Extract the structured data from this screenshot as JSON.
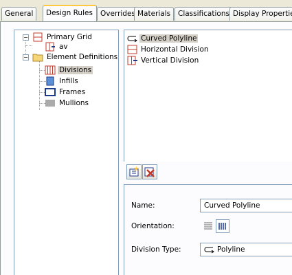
{
  "tabs": [
    {
      "label": "General"
    },
    {
      "label": "Design Rules"
    },
    {
      "label": "Overrides"
    },
    {
      "label": "Materials"
    },
    {
      "label": "Classifications"
    },
    {
      "label": "Display Properties"
    }
  ],
  "tree": {
    "primary_grid": "Primary Grid",
    "av": "av",
    "element_definitions": "Element Definitions",
    "divisions": "Divisions",
    "infills": "Infills",
    "frames": "Frames",
    "mullions": "Mullions"
  },
  "list": {
    "items": [
      {
        "label": "Curved Polyline"
      },
      {
        "label": "Horizontal Division"
      },
      {
        "label": "Vertical Division"
      }
    ]
  },
  "properties": {
    "name_label": "Name:",
    "name_value": "Curved Polyline",
    "orientation_label": "Orientation:",
    "division_type_label": "Division Type:",
    "division_type_value": "Polyline"
  },
  "colors": {
    "tab_active_accent": "#ffc83c",
    "border": "#7f9db9",
    "panel_bg": "#ece9d8",
    "icon_red": "#c0392b",
    "icon_blue": "#1e3a8a"
  }
}
